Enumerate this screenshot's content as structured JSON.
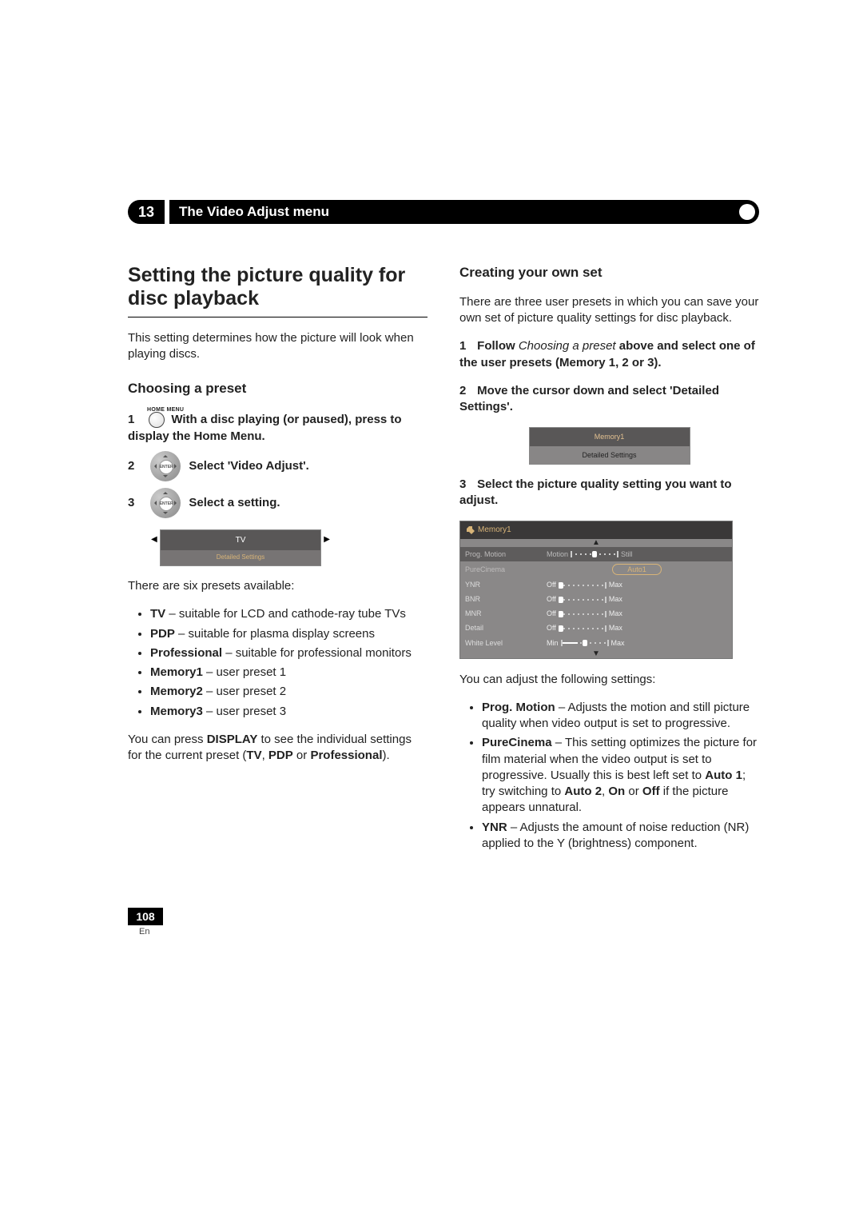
{
  "chapter": {
    "num": "13",
    "title": "The Video Adjust menu"
  },
  "left": {
    "h1": "Setting the picture quality for disc playback",
    "intro": "This setting determines how the picture will look when playing discs.",
    "h2": "Choosing a preset",
    "homemenu": "HOME MENU",
    "step1_num": "1",
    "step1": "With a disc playing (or paused), press to display the Home Menu.",
    "step2_num": "2",
    "step2": "Select 'Video Adjust'.",
    "step3_num": "3",
    "step3": "Select a setting.",
    "dpad_center": "ENTER",
    "osd1": {
      "line1": "TV",
      "line2": "Detailed Settings",
      "left_arrow": "◀",
      "right_arrow": "▶"
    },
    "presets_intro": "There are six presets available:",
    "presets": [
      {
        "b": "TV",
        "t": " – suitable for LCD and cathode-ray tube TVs"
      },
      {
        "b": "PDP",
        "t": " – suitable for plasma display screens"
      },
      {
        "b": "Professional",
        "t": " – suitable for professional monitors"
      },
      {
        "b": "Memory1",
        "t": " – user preset 1"
      },
      {
        "b": "Memory2",
        "t": " – user preset 2"
      },
      {
        "b": "Memory3",
        "t": " – user preset 3"
      }
    ],
    "tail_a": "You can press ",
    "tail_b": "DISPLAY",
    "tail_c": " to see the individual settings for the current preset (",
    "tail_d": "TV",
    "tail_e": ", ",
    "tail_f": "PDP",
    "tail_g": " or ",
    "tail_h": "Professional",
    "tail_i": ")."
  },
  "right": {
    "h2": "Creating your own set",
    "intro": "There are three user presets in which you can save your own set of picture quality settings for disc playback.",
    "s1_num": "1",
    "s1_a": "Follow ",
    "s1_b": "Choosing a preset",
    "s1_c": " above and select one of the user presets (Memory 1, 2 or 3).",
    "s2_num": "2",
    "s2": "Move the cursor down and select 'Detailed Settings'.",
    "osd2": {
      "r1": "Memory1",
      "r2": "Detailed Settings"
    },
    "s3_num": "3",
    "s3": "Select the picture quality setting you want to adjust.",
    "osd3": {
      "title": "Memory1",
      "up": "▲",
      "down": "▼",
      "rows": [
        {
          "lbl": "Prog. Motion",
          "left": "Motion",
          "right": "Still",
          "kind": "slider_mid",
          "dim": true,
          "sel": true
        },
        {
          "lbl": "PureCinema",
          "center": "Auto1",
          "kind": "pill",
          "dim": true
        },
        {
          "lbl": "YNR",
          "left": "Off",
          "right": "Max",
          "kind": "slider"
        },
        {
          "lbl": "BNR",
          "left": "Off",
          "right": "Max",
          "kind": "slider"
        },
        {
          "lbl": "MNR",
          "left": "Off",
          "right": "Max",
          "kind": "slider"
        },
        {
          "lbl": "Detail",
          "left": "Off",
          "right": "Max",
          "kind": "slider"
        },
        {
          "lbl": "White Level",
          "left": "Min",
          "right": "Max",
          "kind": "slider_fill"
        }
      ]
    },
    "adjust_intro": "You can adjust the following settings:",
    "adjust": [
      {
        "b": "Prog. Motion",
        "t": " – Adjusts the motion and still picture quality when video output is set to progressive."
      },
      {
        "b": "PureCinema",
        "t_a": " – This setting optimizes the picture for film material when the video output is set to progressive. Usually this is best left set to ",
        "t_b": "Auto 1",
        "t_c": "; try switching to ",
        "t_d": "Auto 2",
        "t_e": ", ",
        "t_f": "On",
        "t_g": " or ",
        "t_h": "Off",
        "t_i": " if the picture appears unnatural."
      },
      {
        "b": "YNR",
        "t": " – Adjusts the amount of noise reduction (NR) applied to the Y (brightness) component."
      }
    ]
  },
  "footer": {
    "page": "108",
    "lang": "En"
  }
}
